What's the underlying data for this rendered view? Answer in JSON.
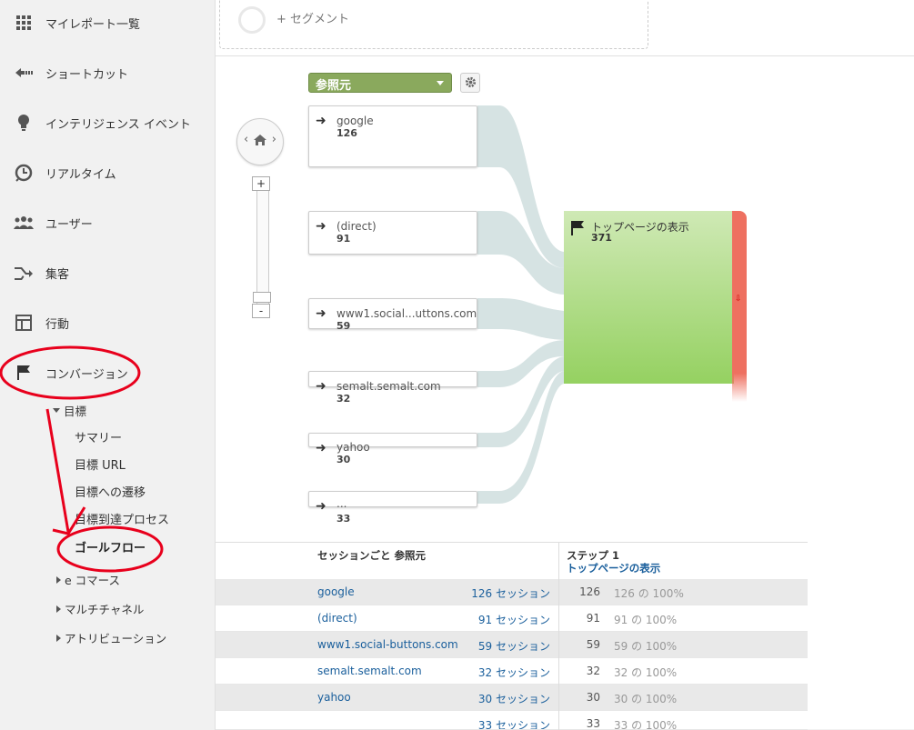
{
  "sidebar": {
    "items": [
      {
        "label": "マイレポート一覧",
        "icon": "grid-icon"
      },
      {
        "label": "ショートカット",
        "icon": "shortcut-arrow-icon"
      },
      {
        "label": "インテリジェンス イベント",
        "icon": "lightbulb-icon"
      },
      {
        "label": "リアルタイム",
        "icon": "clock-icon"
      },
      {
        "label": "ユーザー",
        "icon": "users-icon"
      },
      {
        "label": "集客",
        "icon": "acquisition-arrows-icon"
      },
      {
        "label": "行動",
        "icon": "behavior-layout-icon"
      },
      {
        "label": "コンバージョン",
        "icon": "flag-icon"
      }
    ],
    "goals_group": "目標",
    "goals_items": [
      "サマリー",
      "目標 URL",
      "目標への遷移",
      "目標到達プロセス",
      "ゴールフロー"
    ],
    "more_groups": [
      "e コマース",
      "マルチチャネル",
      "アトリビューション"
    ]
  },
  "segment": {
    "add_label": "+ セグメント"
  },
  "flow": {
    "dimension": "参照元",
    "sources": [
      {
        "name": "google",
        "value": "126"
      },
      {
        "name": "(direct)",
        "value": "91"
      },
      {
        "name": "www1.social...uttons.com",
        "value": "59"
      },
      {
        "name": "semalt.semalt.com",
        "value": "32"
      },
      {
        "name": "yahoo",
        "value": "30"
      },
      {
        "name": "...",
        "value": "33"
      }
    ],
    "goal": {
      "name": "トップページの表示",
      "value": "371"
    },
    "zoom_in": "+",
    "zoom_out": "-",
    "colors": {
      "dimension": "#8aa95d",
      "goal": "#95d161",
      "exit": "#ee7060",
      "link": "#1a5f9c"
    }
  },
  "table": {
    "col1_header": "セッションごと 参照元",
    "col2_header": "ステップ 1",
    "col2_sub": "トップページの表示",
    "rows": [
      {
        "source": "google",
        "sessions": "126 セッション",
        "count": "126",
        "pct": "126 の 100%"
      },
      {
        "source": "(direct)",
        "sessions": "91 セッション",
        "count": "91",
        "pct": "91 の 100%"
      },
      {
        "source": "www1.social-buttons.com",
        "sessions": "59 セッション",
        "count": "59",
        "pct": "59 の 100%"
      },
      {
        "source": "semalt.semalt.com",
        "sessions": "32 セッション",
        "count": "32",
        "pct": "32 の 100%"
      },
      {
        "source": "yahoo",
        "sessions": "30 セッション",
        "count": "30",
        "pct": "30 の 100%"
      },
      {
        "source": "",
        "sessions": "33 セッション",
        "count": "33",
        "pct": "33 の 100%"
      }
    ]
  }
}
